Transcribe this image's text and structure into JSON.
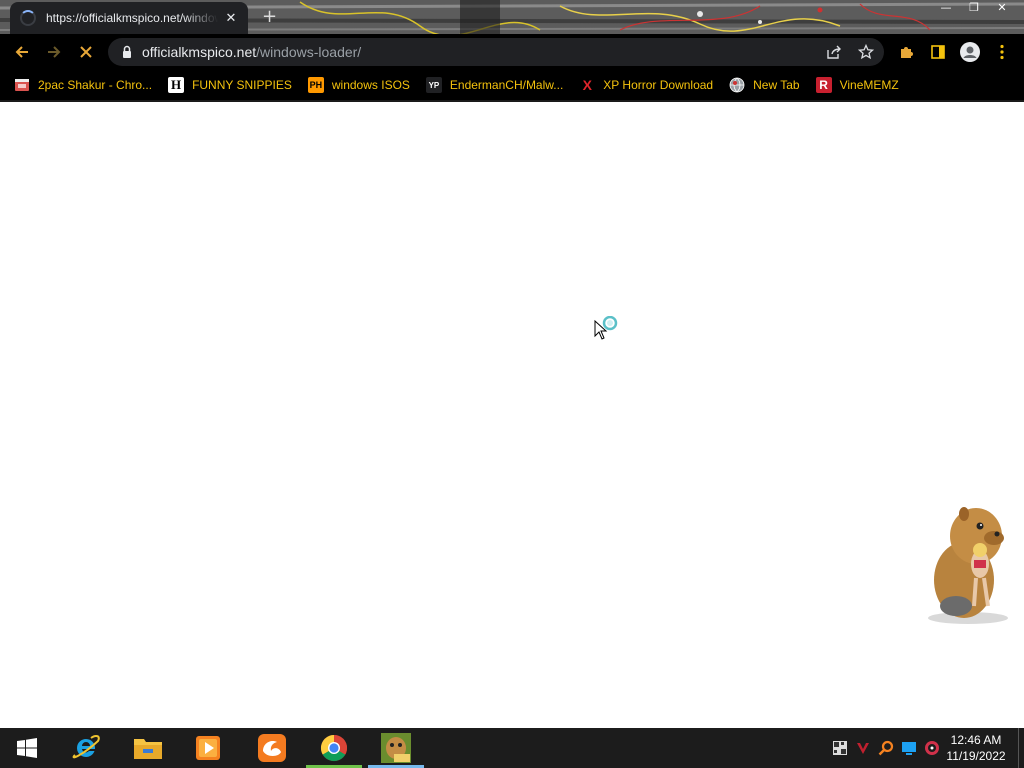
{
  "tab": {
    "title": "https://officialkmspico.net/windows-loader/",
    "close_glyph": "✕",
    "new_tab_glyph": "+"
  },
  "window_controls": [
    "—",
    "❐",
    "✕"
  ],
  "omnibox": {
    "host": "officialkmspico.net",
    "path": "/windows-loader/"
  },
  "bookmarks": [
    {
      "label": "2pac Shakur - Chro...",
      "icon": "film-icon",
      "badge": "",
      "bg": "#202124",
      "fg": "#e8eaed"
    },
    {
      "label": "FUNNY SNIPPIES",
      "icon": "h-icon",
      "badge": "H",
      "bg": "#ffffff",
      "fg": "#000000"
    },
    {
      "label": "windows ISOS",
      "icon": "ph-icon",
      "badge": "PH",
      "bg": "#f90",
      "fg": "#000000"
    },
    {
      "label": "EndermanCH/Malw...",
      "icon": "yp-icon",
      "badge": "YP",
      "bg": "#202124",
      "fg": "#ffffff"
    },
    {
      "label": "XP Horror Download",
      "icon": "x-icon",
      "badge": "X",
      "bg": "#000000",
      "fg": "#e0242b"
    },
    {
      "label": "New Tab",
      "icon": "globe-icon",
      "badge": "",
      "bg": "#202124",
      "fg": "#ffffff"
    },
    {
      "label": "VineMEMZ",
      "icon": "r-icon",
      "badge": "R",
      "bg": "#c8202f",
      "fg": "#ffffff"
    }
  ],
  "clock": {
    "time": "12:46 AM",
    "date": "11/19/2022"
  },
  "taskbar_apps": [
    "internet-explorer-icon",
    "file-explorer-icon",
    "media-player-icon",
    "uc-browser-icon",
    "chrome-icon",
    "bonzi-box-icon"
  ],
  "colors": {
    "bookmark_text": "#f4c20d",
    "toolbar_bg": "#000000",
    "omnibox_bg": "#202124",
    "taskbar_bg": "#1c1c1c"
  }
}
